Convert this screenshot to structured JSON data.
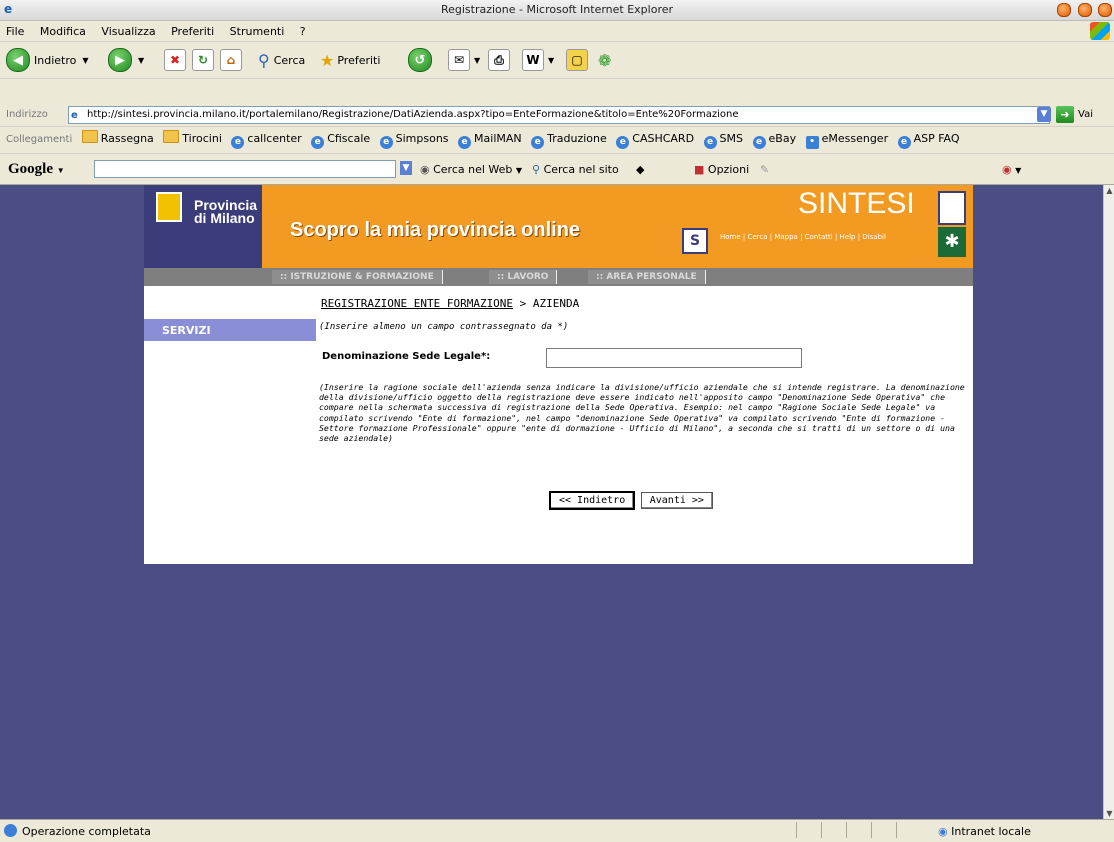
{
  "window": {
    "title": "Registrazione - Microsoft Internet Explorer"
  },
  "menu": [
    "File",
    "Modifica",
    "Visualizza",
    "Preferiti",
    "Strumenti",
    "?"
  ],
  "toolbar": {
    "back": "Indietro",
    "search": "Cerca",
    "favorites": "Preferiti"
  },
  "address": {
    "label": "Indirizzo",
    "url": "http://sintesi.provincia.milano.it/portalemilano/Registrazione/DatiAzienda.aspx?tipo=EnteFormazione&titolo=Ente%20Formazione",
    "go": "Vai"
  },
  "links": {
    "label": "Collegamenti",
    "items": [
      "Rassegna",
      "Tirocini",
      "callcenter",
      "Cfiscale",
      "Simpsons",
      "MailMAN",
      "Traduzione",
      "CASHCARD",
      "SMS",
      "eBay",
      "eMessenger",
      "ASP FAQ"
    ]
  },
  "google": {
    "logo": "Google",
    "search_web": "Cerca nel Web",
    "search_site": "Cerca nel sito",
    "options": "Opzioni"
  },
  "site": {
    "brand_line1": "Provincia",
    "brand_line2": "di Milano",
    "slogan": "Scopro la mia provincia online",
    "logo_text": "SINTESI",
    "top_links": "Home | Cerca | Mappa | Contatti | Help | Disabil",
    "nav": [
      ":: ISTRUZIONE & FORMAZIONE",
      ":: LAVORO",
      ":: AREA PERSONALE"
    ],
    "sidebar_label": "SERVIZI"
  },
  "page": {
    "crumb_link": "REGISTRAZIONE ENTE FORMAZIONE",
    "crumb_rest": " > AZIENDA",
    "hint": "(Inserire almeno un campo contrassegnato da *)",
    "field_label": "Denominazione Sede Legale*:",
    "field_value": "",
    "note": "(Inserire la ragione sociale dell'azienda senza indicare la divisione/ufficio aziendale che si intende registrare. La denominazione della divisione/ufficio oggetto della registrazione deve essere indicato nell'apposito campo \"Denominazione Sede Operativa\" che compare nella schermata successiva di registrazione della Sede Operativa. Esempio: nel campo \"Ragione Sociale Sede Legale\" va compilato scrivendo \"Ente di formazione\", nel campo \"denominazione Sede Operativa\" va compilato scrivendo \"Ente di formazione - Settore formazione Professionale\" oppure \"ente di dormazione - Ufficio di Milano\", a seconda che si tratti di un settore o di una sede aziendale)",
    "back_button": "<< Indietro",
    "next_button": "Avanti >>"
  },
  "status": {
    "message": "Operazione completata",
    "zone": "Intranet locale"
  }
}
